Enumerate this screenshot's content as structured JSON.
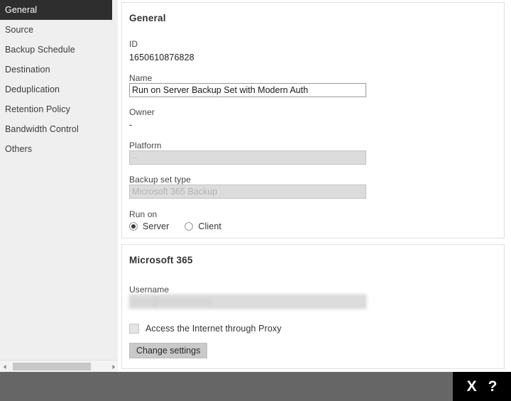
{
  "sidebar": {
    "items": [
      {
        "label": "General",
        "selected": true
      },
      {
        "label": "Source",
        "selected": false
      },
      {
        "label": "Backup Schedule",
        "selected": false
      },
      {
        "label": "Destination",
        "selected": false
      },
      {
        "label": "Deduplication",
        "selected": false
      },
      {
        "label": "Retention Policy",
        "selected": false
      },
      {
        "label": "Bandwidth Control",
        "selected": false
      },
      {
        "label": "Others",
        "selected": false
      }
    ],
    "scrollbar": {
      "left_arrow": "◀",
      "right_arrow": "▶"
    }
  },
  "general_panel": {
    "title": "General",
    "id_label": "ID",
    "id_value": "1650610876828",
    "name_label": "Name",
    "name_value": "Run on Server Backup Set with Modern Auth",
    "owner_label": "Owner",
    "owner_value": "-",
    "platform_label": "Platform",
    "platform_value": "--",
    "backup_set_type_label": "Backup set type",
    "backup_set_type_value": "Microsoft 365 Backup",
    "run_on_label": "Run on",
    "run_on_options": [
      {
        "label": "Server",
        "selected": true
      },
      {
        "label": "Client",
        "selected": false
      }
    ]
  },
  "m365_panel": {
    "title": "Microsoft 365",
    "username_label": "Username",
    "username_value": "xxxx@xxxxxxxxxxx",
    "proxy_checkbox_label": "Access the Internet through Proxy",
    "proxy_checked": false,
    "change_settings_label": "Change settings"
  },
  "bottom_bar": {
    "close_glyph": "X",
    "help_glyph": "?"
  },
  "colors": {
    "sidebar_bg": "#efefef",
    "sidebar_selected_bg": "#2e2e2e",
    "panel_border": "#e0e0e0",
    "readonly_field_bg": "#dcdcdc",
    "button_bg": "#c9c9c9",
    "bottom_bar_bg": "#666666",
    "tool_area_bg": "#000000"
  }
}
